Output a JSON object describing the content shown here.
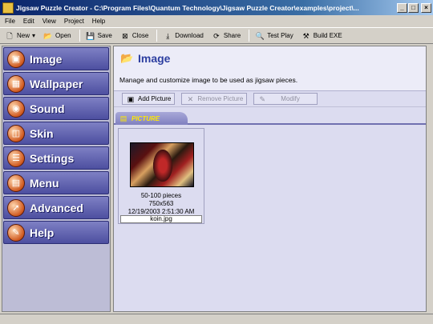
{
  "window": {
    "title": "Jigsaw Puzzle Creator - C:\\Program Files\\Quantum Technology\\Jigsaw Puzzle Creator\\examples\\project\\..."
  },
  "menu": [
    "File",
    "Edit",
    "View",
    "Project",
    "Help"
  ],
  "toolbar": {
    "new": "New",
    "open": "Open",
    "save": "Save",
    "close": "Close",
    "download": "Download",
    "share": "Share",
    "test_play": "Test Play",
    "build_exe": "Build EXE"
  },
  "sidebar": {
    "items": [
      {
        "label": "Image",
        "icon": "image-icon"
      },
      {
        "label": "Wallpaper",
        "icon": "wallpaper-icon"
      },
      {
        "label": "Sound",
        "icon": "sound-icon"
      },
      {
        "label": "Skin",
        "icon": "skin-icon"
      },
      {
        "label": "Settings",
        "icon": "settings-icon"
      },
      {
        "label": "Menu",
        "icon": "menu-icon"
      },
      {
        "label": "Advanced",
        "icon": "advanced-icon"
      },
      {
        "label": "Help",
        "icon": "help-icon"
      }
    ]
  },
  "panel": {
    "title": "Image",
    "description": "Manage and customize image to be used as jigsaw pieces.",
    "actions": {
      "add": "Add Picture",
      "remove": "Remove Picture",
      "modify": "Modify"
    },
    "tab": "PICTURE",
    "picture": {
      "pieces": "50-100 pieces",
      "dimensions": "750x563",
      "date": "12/19/2003 2:51:30 AM",
      "filename": "koin.jpg"
    }
  },
  "colors": {
    "sidebar_button": "#5a5cad",
    "panel_title": "#2c3ea0",
    "tab_label": "#ffe800"
  }
}
